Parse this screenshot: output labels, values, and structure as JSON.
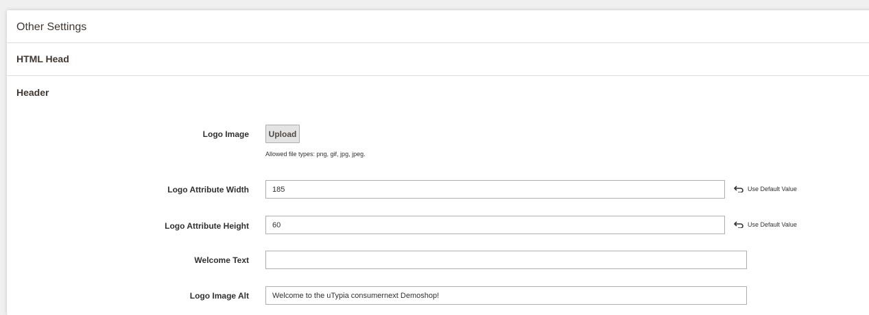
{
  "sections": {
    "other_settings": "Other Settings",
    "html_head": "HTML Head",
    "header": "Header"
  },
  "fields": {
    "logo_image": {
      "label": "Logo Image",
      "button": "Upload",
      "note": "Allowed file types: png, gif, jpg, jpeg."
    },
    "logo_width": {
      "label": "Logo Attribute Width",
      "value": "185",
      "default_link": "Use Default Value"
    },
    "logo_height": {
      "label": "Logo Attribute Height",
      "value": "60",
      "default_link": "Use Default Value"
    },
    "welcome_text": {
      "label": "Welcome Text",
      "value": ""
    },
    "logo_alt": {
      "label": "Logo Image Alt",
      "value": "Welcome to the uTypia consumernext Demoshop!"
    }
  },
  "icons": {
    "use_default": "undo-arrow-icon"
  }
}
